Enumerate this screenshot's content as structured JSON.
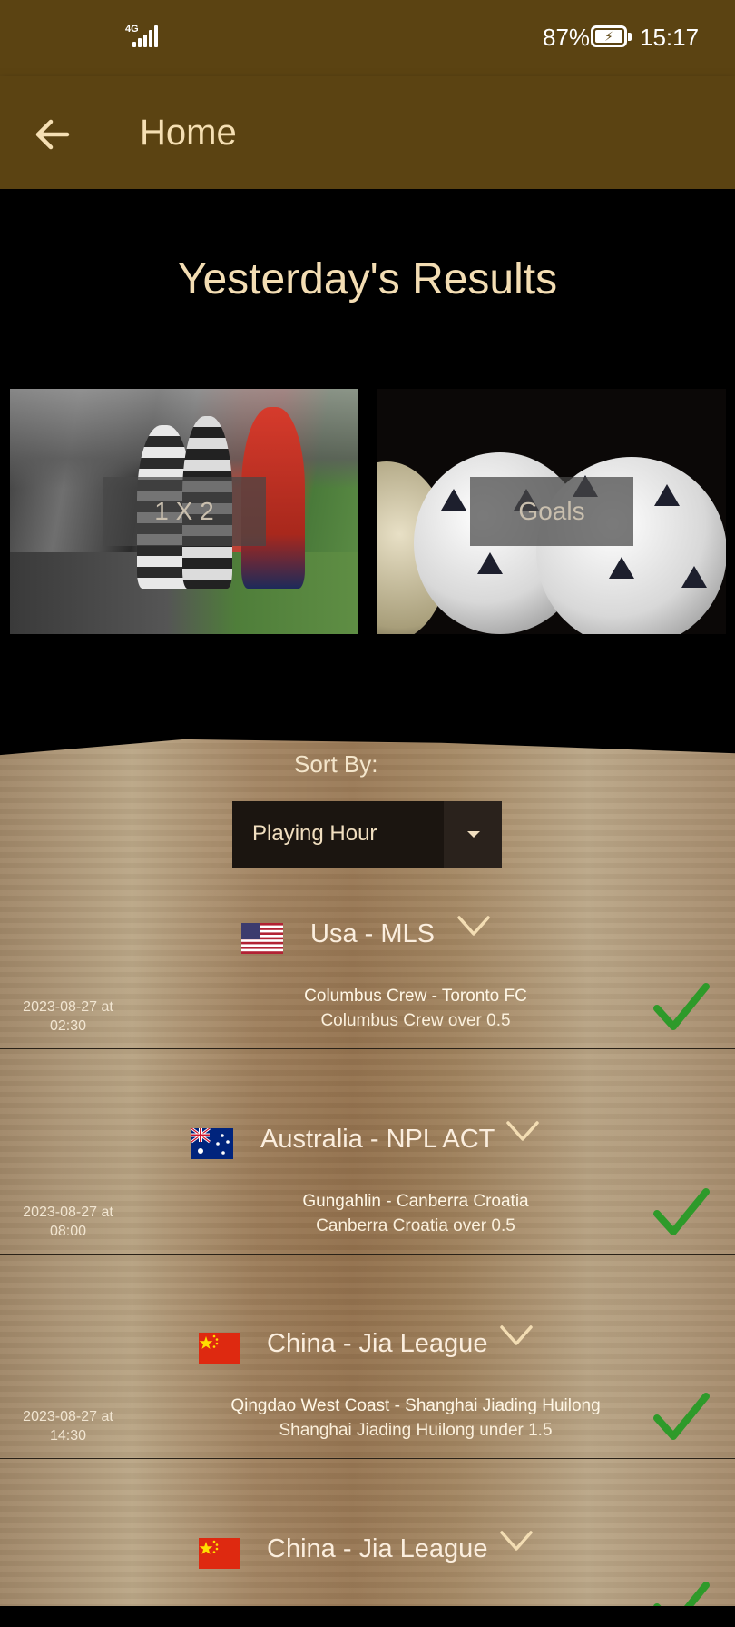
{
  "status_bar": {
    "network": "4G",
    "battery_percent": "87%",
    "time": "15:17"
  },
  "app_bar": {
    "title": "Home"
  },
  "section_title": "Yesterday's Results",
  "cards": [
    {
      "label": "1 X 2"
    },
    {
      "label": "Goals"
    }
  ],
  "sort": {
    "label": "Sort By:",
    "selected": "Playing Hour"
  },
  "leagues": [
    {
      "name": "Usa - MLS",
      "flag": "us-flag",
      "matches": [
        {
          "date": "2023-08-27 at",
          "time": "02:30",
          "teams": "Columbus Crew - Toronto FC",
          "tip": "Columbus Crew over 0.5",
          "result": "won"
        }
      ]
    },
    {
      "name": "Australia - NPL ACT",
      "flag": "au-flag",
      "matches": [
        {
          "date": "2023-08-27 at",
          "time": "08:00",
          "teams": "Gungahlin - Canberra Croatia",
          "tip": "Canberra Croatia over 0.5",
          "result": "won"
        }
      ]
    },
    {
      "name": "China - Jia League",
      "flag": "cn-flag",
      "matches": [
        {
          "date": "2023-08-27 at",
          "time": "14:30",
          "teams": "Qingdao West Coast - Shanghai Jiading Huilong",
          "tip": "Shanghai Jiading Huilong under 1.5",
          "result": "won"
        }
      ]
    },
    {
      "name": "China - Jia League",
      "flag": "cn-flag",
      "matches": []
    }
  ],
  "colors": {
    "app_bar": "#5b4312",
    "accent_text": "#f3ddb3",
    "check_green": "#2e9a2a"
  }
}
